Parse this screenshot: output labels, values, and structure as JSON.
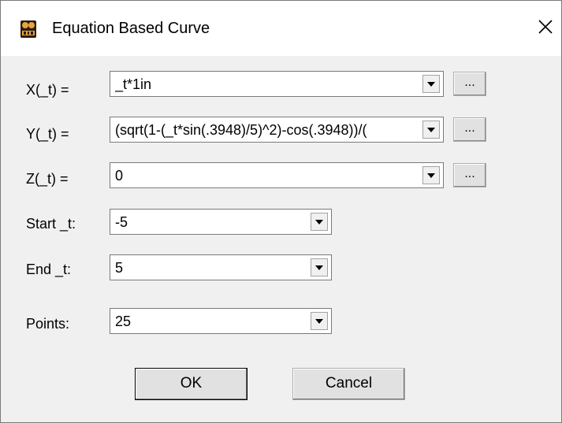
{
  "window": {
    "title": "Equation Based Curve"
  },
  "fields": {
    "x": {
      "label": "X(_t) =",
      "value": "_t*1in",
      "button_label": "..."
    },
    "y": {
      "label": "Y(_t) =",
      "value": "(sqrt(1-(_t*sin(.3948)/5)^2)-cos(.3948))/(",
      "button_label": "..."
    },
    "z": {
      "label": "Z(_t) =",
      "value": "0",
      "button_label": "..."
    },
    "start": {
      "label": "Start _t:",
      "value": "-5"
    },
    "end": {
      "label": "End _t:",
      "value": "5"
    },
    "points": {
      "label": "Points:",
      "value": "25"
    }
  },
  "buttons": {
    "ok": "OK",
    "cancel": "Cancel"
  },
  "icons": {
    "app": "edt-app-icon",
    "close": "close-icon",
    "dropdown": "chevron-down-icon"
  }
}
